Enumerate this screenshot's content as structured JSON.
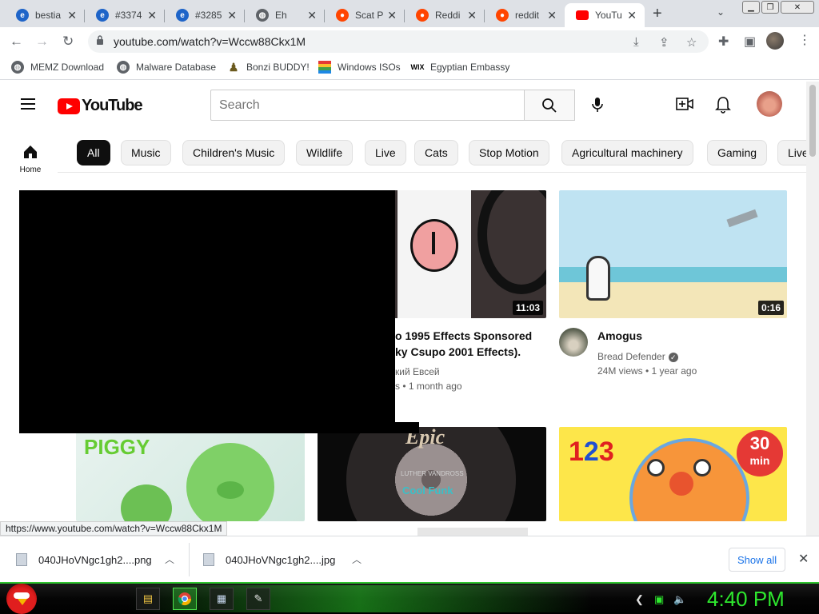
{
  "browser": {
    "tabs": [
      {
        "label": "bestia",
        "icon": "ie-icon"
      },
      {
        "label": "#3374",
        "icon": "ie-icon"
      },
      {
        "label": "#3285",
        "icon": "ie-icon"
      },
      {
        "label": "Eh",
        "icon": "globe-icon"
      },
      {
        "label": "Scat P",
        "icon": "reddit-icon"
      },
      {
        "label": "Reddi",
        "icon": "reddit-icon"
      },
      {
        "label": "reddit",
        "icon": "reddit-icon"
      },
      {
        "label": "YouTu",
        "icon": "youtube-icon",
        "active": true
      }
    ],
    "new_tab": "+",
    "url": "youtube.com/watch?v=Wccw88Ckx1M",
    "bookmarks": [
      {
        "label": "MEMZ Download",
        "icon": "globe-icon"
      },
      {
        "label": "Malware Database",
        "icon": "globe-icon"
      },
      {
        "label": "Bonzi BUDDY!",
        "icon": "bonzi-icon"
      },
      {
        "label": "Windows ISOs",
        "icon": "windows-flag-icon"
      },
      {
        "label": "Egyptian Embassy",
        "icon": "wix-icon"
      }
    ],
    "wix_text": "WIX",
    "status_url": "https://www.youtube.com/watch?v=Wccw88Ckx1M"
  },
  "youtube": {
    "logo_text": "YouTube",
    "search_placeholder": "Search",
    "sidebar_home": "Home",
    "chips": [
      "All",
      "Music",
      "Children's Music",
      "Wildlife",
      "Live",
      "Cats",
      "Stop Motion",
      "Agricultural machinery",
      "Gaming",
      "Live"
    ],
    "videos": [
      {
        "title_line1": "o 1995 Effects Sponsored",
        "title_line2": "ky Csupo 2001 Effects).",
        "channel": "кий Евсей",
        "meta": "s • 1 month ago",
        "duration": "11:03"
      },
      {
        "title_line1": "Amogus",
        "channel": "Bread Defender",
        "verified": "✓",
        "meta": "24M views • 1 year ago",
        "duration": "0:16"
      }
    ],
    "thumb_text": {
      "piggy": "PIGGY",
      "epic": "Epic",
      "epic_artist": "LUTHER VANDROSS",
      "epic_song": "Cool Funk",
      "counting_badge_num": "30",
      "counting_badge_unit": "min",
      "counting_digits": [
        "1",
        "2",
        "3"
      ]
    }
  },
  "downloads": [
    {
      "name": "040JHoVNgc1gh2....png"
    },
    {
      "name": "040JHoVNgc1gh2....jpg"
    }
  ],
  "downloads_show_all": "Show all",
  "taskbar": {
    "clock": "4:40 PM"
  }
}
